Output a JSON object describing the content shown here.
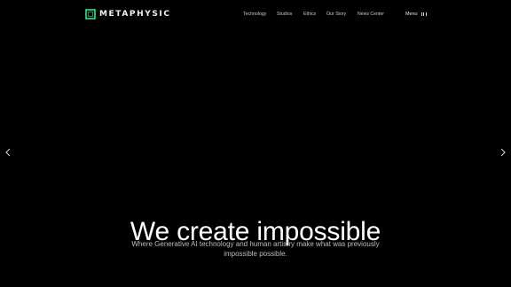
{
  "brand": {
    "name": "METAPHYSIC",
    "accent_color": "#2fe58b",
    "logo_icon": "square-frame-icon"
  },
  "nav": {
    "items": [
      {
        "label": "Technology"
      },
      {
        "label": "Studios"
      },
      {
        "label": "Ethics"
      },
      {
        "label": "Our Story"
      },
      {
        "label": "News Center"
      }
    ],
    "menu_label": "Menu",
    "menu_icon": "three-bars-icon"
  },
  "carousel": {
    "prev_icon": "chevron-left-icon",
    "next_icon": "chevron-right-icon"
  },
  "hero": {
    "title": "We create impossible",
    "subtitle": "Where Generative AI technology and human artistry make what was previously impossible possible."
  },
  "colors": {
    "background": "#000000",
    "text": "#ffffff",
    "nav_text": "#c9c9c9",
    "subtitle_text": "#bdbdbd"
  }
}
